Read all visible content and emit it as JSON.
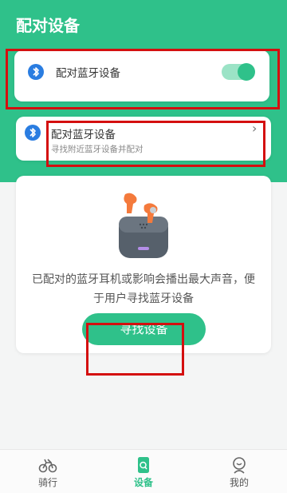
{
  "header": {
    "title": "配对设备"
  },
  "pair_card": {
    "label": "配对蓝牙设备",
    "toggle_on": true
  },
  "pair_row": {
    "label": "配对蓝牙设备",
    "subtitle": "寻找附近蓝牙设备并配对"
  },
  "find_section": {
    "description": "已配对的蓝牙耳机或影响会播出最大声音，便于用户寻找蓝牙设备",
    "button_label": "寻找设备"
  },
  "tabbar": {
    "tabs": [
      {
        "label": "骑行",
        "icon": "bike-icon",
        "active": false
      },
      {
        "label": "设备",
        "icon": "device-search-icon",
        "active": true
      },
      {
        "label": "我的",
        "icon": "profile-icon",
        "active": false
      }
    ]
  },
  "colors": {
    "accent": "#2fc18a",
    "highlight": "#d40f0f"
  }
}
